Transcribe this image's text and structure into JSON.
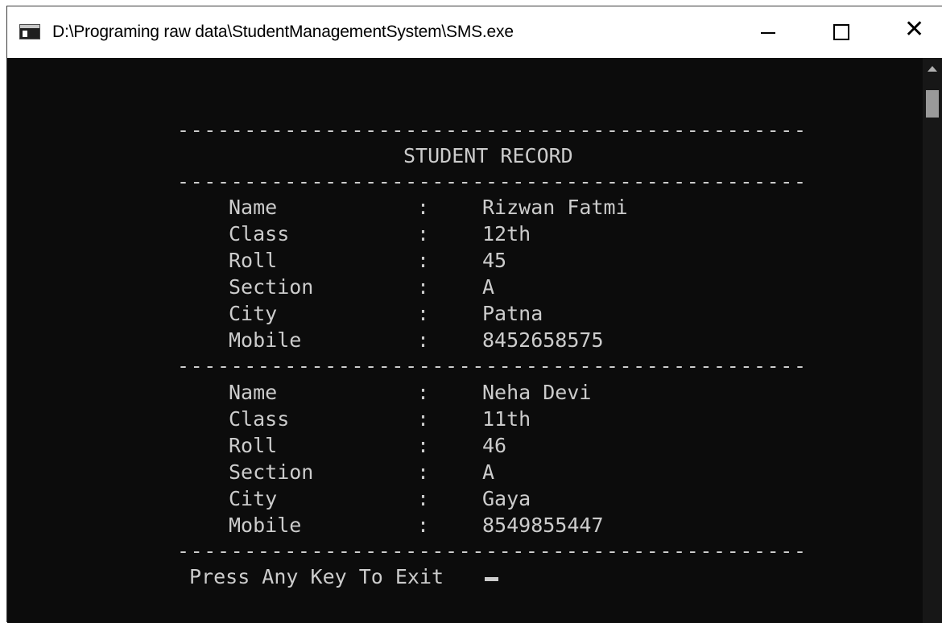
{
  "window": {
    "title": "D:\\Programing raw data\\StudentManagementSystem\\SMS.exe",
    "icon": "console-app-icon",
    "controls": {
      "minimize": "minimize-icon",
      "maximize": "maximize-icon",
      "close_glyph": "✕"
    }
  },
  "console": {
    "separator": "-----------------------------------------------",
    "header": "STUDENT RECORD",
    "colon": ":",
    "records": [
      {
        "fields": [
          {
            "label": "Name",
            "value": "Rizwan Fatmi"
          },
          {
            "label": "Class",
            "value": "12th"
          },
          {
            "label": "Roll",
            "value": "45"
          },
          {
            "label": "Section",
            "value": "A"
          },
          {
            "label": "City",
            "value": "Patna"
          },
          {
            "label": "Mobile",
            "value": "8452658575"
          }
        ]
      },
      {
        "fields": [
          {
            "label": "Name",
            "value": "Neha Devi"
          },
          {
            "label": "Class",
            "value": "11th"
          },
          {
            "label": "Roll",
            "value": "46"
          },
          {
            "label": "Section",
            "value": "A"
          },
          {
            "label": "City",
            "value": "Gaya"
          },
          {
            "label": "Mobile",
            "value": "8549855447"
          }
        ]
      }
    ],
    "prompt": "Press Any Key To Exit"
  },
  "colors": {
    "console_bg": "#0c0c0c",
    "console_text": "#cccccc",
    "titlebar_bg": "#ffffff"
  }
}
